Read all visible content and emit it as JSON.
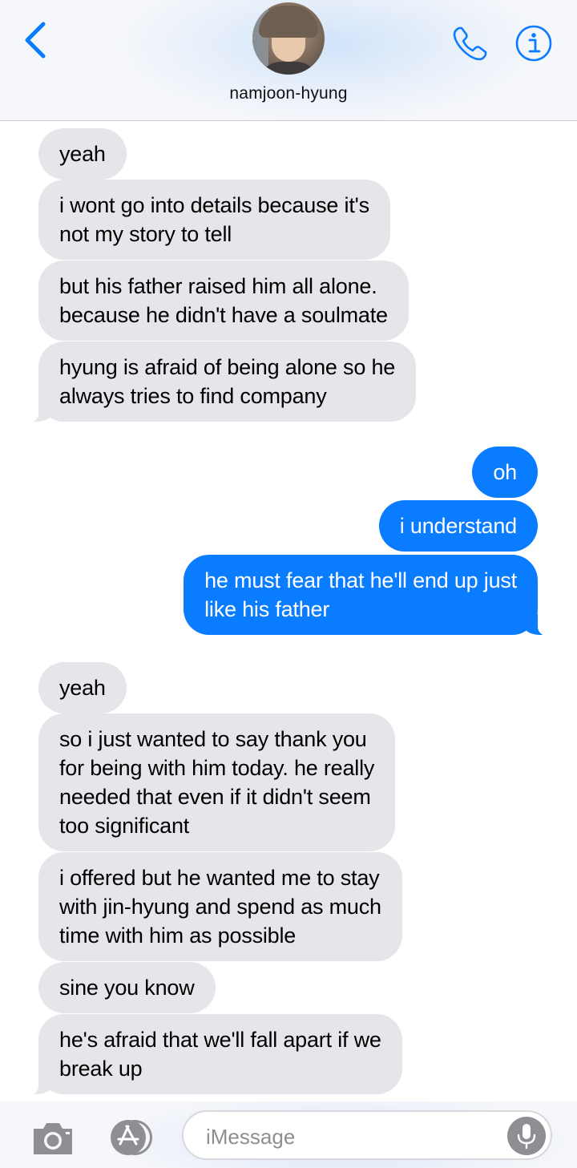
{
  "header": {
    "contact_name": "namjoon-hyung",
    "accent_color": "#0a7cff",
    "icons": [
      "back-chevron-icon",
      "phone-icon",
      "info-icon"
    ]
  },
  "messages": [
    {
      "id": "m1",
      "side": "received",
      "text": "yeah"
    },
    {
      "id": "m2",
      "side": "received",
      "text": "i wont go into details because it's\nnot my story to tell"
    },
    {
      "id": "m3",
      "side": "received",
      "text": "but his father raised him all alone.\nbecause he didn't have a soulmate"
    },
    {
      "id": "m4",
      "side": "received",
      "text": "hyung is afraid of being alone so he\nalways tries to find company"
    },
    {
      "id": "m5",
      "side": "sent",
      "text": "oh"
    },
    {
      "id": "m6",
      "side": "sent",
      "text": "i understand"
    },
    {
      "id": "m7",
      "side": "sent",
      "text": "he must fear that he'll end up just\nlike his father"
    },
    {
      "id": "m8",
      "side": "received",
      "text": "yeah"
    },
    {
      "id": "m9",
      "side": "received",
      "text": "so i just wanted to say thank you\nfor being with him today. he really\nneeded that even if it didn't seem\ntoo significant"
    },
    {
      "id": "m10",
      "side": "received",
      "text": "i offered but he wanted me to stay\nwith jin-hyung and spend as much\ntime with him as possible"
    },
    {
      "id": "m11",
      "side": "received",
      "text": "sine you know"
    },
    {
      "id": "m12",
      "side": "received",
      "text": "he's afraid that we'll fall apart if we\nbreak up"
    }
  ],
  "composer": {
    "placeholder": "iMessage",
    "icons": [
      "camera-icon",
      "app-store-icon",
      "microphone-icon"
    ]
  },
  "colors": {
    "received_bubble": "#e5e5ea",
    "sent_bubble": "#0a7cff",
    "header_bg": "#f6f7fa"
  }
}
